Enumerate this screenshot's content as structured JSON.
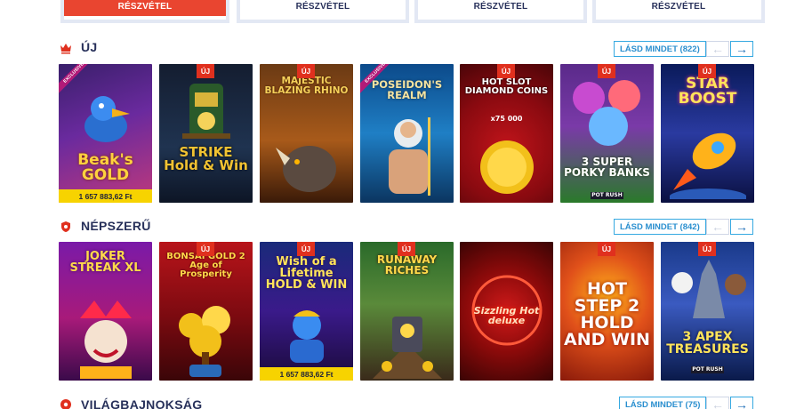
{
  "promo": {
    "buttons": [
      "RÉSZVÉTEL",
      "RÉSZVÉTEL",
      "RÉSZVÉTEL",
      "RÉSZVÉTEL"
    ]
  },
  "sections": [
    {
      "title": "ÚJ",
      "see_all": "LÁSD MINDET (822)",
      "games": [
        {
          "name": "Beaks Gold",
          "logo": "Beak's GOLD",
          "badge": "",
          "exclusive": "EXCLUSIVE",
          "jackpot": "1 657 883,62 Ft"
        },
        {
          "name": "Strike Hold & Win",
          "logo": "STRIKE Hold & Win",
          "badge": "ÚJ",
          "exclusive": "",
          "jackpot": ""
        },
        {
          "name": "Majestic Blazing Rhino",
          "logo": "MAJESTIC BLAZING RHINO",
          "badge": "ÚJ",
          "exclusive": "",
          "jackpot": ""
        },
        {
          "name": "Poseidon's Realm",
          "logo": "POSEIDON'S REALM",
          "badge": "",
          "exclusive": "EXCLUSIVE",
          "jackpot": ""
        },
        {
          "name": "Hot Slot Diamond Coins",
          "logo": "HOT SLOT DIAMOND COINS",
          "sub": "x75 000",
          "badge": "ÚJ",
          "exclusive": "",
          "jackpot": ""
        },
        {
          "name": "3 Super Porky Banks",
          "logo": "3 SUPER PORKY BANKS",
          "sub": "POT RUSH",
          "badge": "ÚJ",
          "exclusive": "",
          "jackpot": ""
        },
        {
          "name": "Star Boost",
          "logo": "STAR BOOST",
          "badge": "ÚJ",
          "exclusive": "",
          "jackpot": ""
        }
      ]
    },
    {
      "title": "NÉPSZERŰ",
      "see_all": "LÁSD MINDET (842)",
      "games": [
        {
          "name": "Joker Streak XL",
          "logo": "JOKER STREAK XL",
          "badge": "",
          "exclusive": "",
          "jackpot": ""
        },
        {
          "name": "Bonsai Gold 2",
          "logo": "BONSAI GOLD 2 Age of Prosperity",
          "badge": "ÚJ",
          "exclusive": "",
          "jackpot": ""
        },
        {
          "name": "Wish of a Lifetime",
          "logo": "Wish of a Lifetime HOLD & WIN",
          "badge": "ÚJ",
          "exclusive": "",
          "jackpot": "1 657 883,62 Ft"
        },
        {
          "name": "Runaway Riches",
          "logo": "RUNAWAY RICHES",
          "badge": "ÚJ",
          "exclusive": "",
          "jackpot": ""
        },
        {
          "name": "Sizzling Hot Deluxe",
          "logo": "Sizzling Hot deluxe",
          "badge": "",
          "exclusive": "",
          "jackpot": ""
        },
        {
          "name": "Hot Step 2",
          "logo": "HOT STEP 2 HOLD AND WIN",
          "badge": "ÚJ",
          "exclusive": "",
          "jackpot": ""
        },
        {
          "name": "3 Apex Treasures",
          "logo": "3 APEX TREASURES",
          "sub": "POT RUSH",
          "badge": "ÚJ",
          "exclusive": "",
          "jackpot": ""
        }
      ]
    },
    {
      "title": "VILÁGBAJNOKSÁG",
      "see_all": "LÁSD MINDET (75)",
      "games": []
    }
  ],
  "nav": {
    "prev": "←",
    "next": "→"
  },
  "colors": {
    "accent": "#e94530",
    "link": "#36a9e1",
    "title": "#27305a",
    "jackpot": "#f7d300"
  }
}
